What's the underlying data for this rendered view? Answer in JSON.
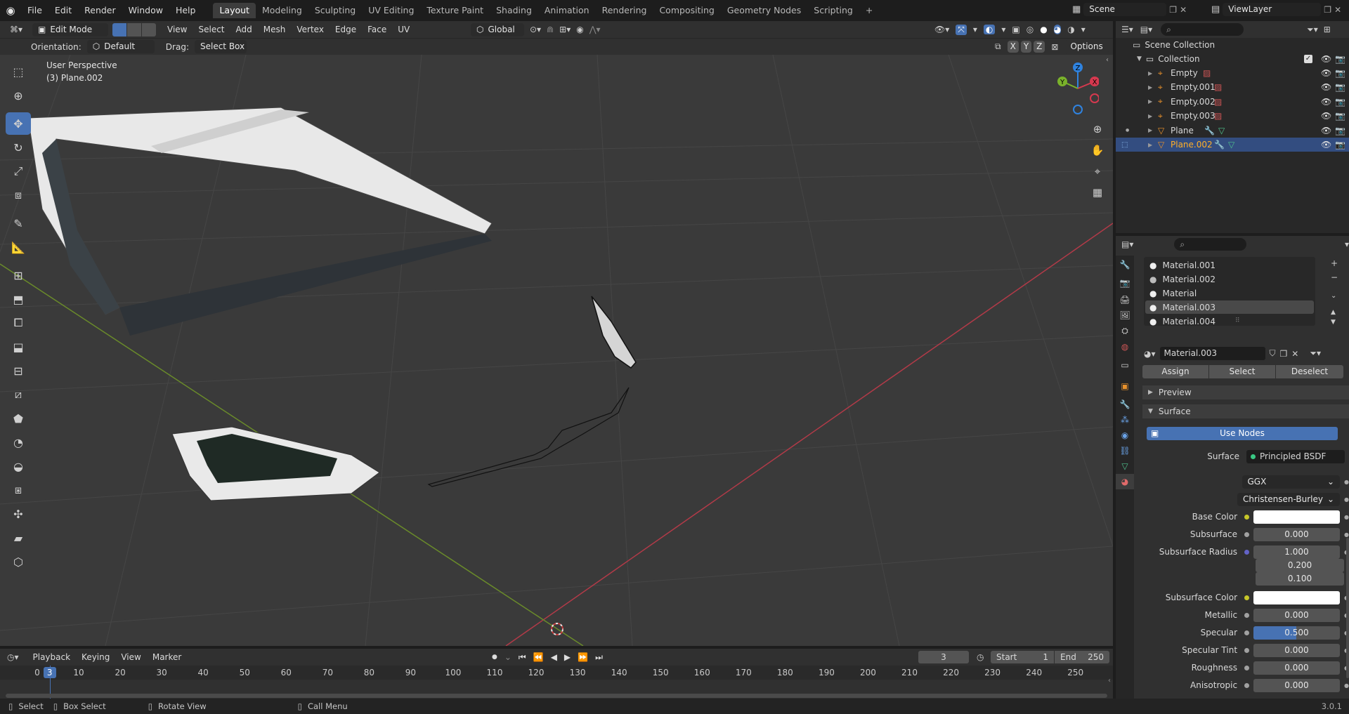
{
  "topbar": {
    "menus": [
      "File",
      "Edit",
      "Render",
      "Window",
      "Help"
    ],
    "workspaces": [
      "Layout",
      "Modeling",
      "Sculpting",
      "UV Editing",
      "Texture Paint",
      "Shading",
      "Animation",
      "Rendering",
      "Compositing",
      "Geometry Nodes",
      "Scripting"
    ],
    "active_workspace": "Layout",
    "add_tab": "+",
    "scene": "Scene",
    "view_layer": "ViewLayer"
  },
  "viewport_header": {
    "mode": "Edit Mode",
    "menus": [
      "View",
      "Select",
      "Add",
      "Mesh",
      "Vertex",
      "Edge",
      "Face",
      "UV"
    ],
    "transform_orientation": "Global",
    "axes": [
      "X",
      "Y",
      "Z"
    ]
  },
  "tool_settings": {
    "orientation_label": "Orientation:",
    "orientation_value": "Default",
    "drag_label": "Drag:",
    "drag_value": "Select Box",
    "options": "Options"
  },
  "viewport": {
    "view_name": "User Perspective",
    "object_info": "(3) Plane.002",
    "gizmo_labels": {
      "z": "Z",
      "y": "Y",
      "x": "X"
    },
    "colors": {
      "x_axis": "#b23a48",
      "y_axis": "#6a8b2a",
      "grid": "#444444",
      "background": "#3a3a3a"
    }
  },
  "outliner": {
    "root": "Scene Collection",
    "collection": "Collection",
    "items": [
      {
        "name": "Empty",
        "type": "empty",
        "selected": false
      },
      {
        "name": "Empty.001",
        "type": "empty",
        "selected": false
      },
      {
        "name": "Empty.002",
        "type": "empty",
        "selected": false
      },
      {
        "name": "Empty.003",
        "type": "empty",
        "selected": false
      },
      {
        "name": "Plane",
        "type": "mesh",
        "selected": false
      },
      {
        "name": "Plane.002",
        "type": "mesh",
        "selected": true
      }
    ]
  },
  "properties": {
    "material_slots": [
      "Material.001",
      "Material.002",
      "Material",
      "Material.003",
      "Material.004"
    ],
    "active_slot": "Material.003",
    "material_name": "Material.003",
    "buttons": {
      "assign": "Assign",
      "select": "Select",
      "deselect": "Deselect"
    },
    "panels": {
      "preview": "Preview",
      "surface": "Surface"
    },
    "use_nodes": "Use Nodes",
    "surface_label": "Surface",
    "surface_shader": "Principled BSDF",
    "distribution": "GGX",
    "subsurface_method": "Christensen-Burley",
    "fields": [
      {
        "label": "Base Color",
        "value": "",
        "socket": "#c7c729",
        "type": "color"
      },
      {
        "label": "Subsurface",
        "value": "0.000",
        "socket": "#a1a1a1",
        "type": "num"
      },
      {
        "label": "Subsurface Radius",
        "value": "1.000",
        "socket": "#6363c7",
        "type": "num"
      },
      {
        "label": "",
        "value": "0.200",
        "socket": "",
        "type": "num"
      },
      {
        "label": "",
        "value": "0.100",
        "socket": "",
        "type": "num"
      },
      {
        "label": "Subsurface Color",
        "value": "",
        "socket": "#c7c729",
        "type": "color"
      },
      {
        "label": "Metallic",
        "value": "0.000",
        "socket": "#a1a1a1",
        "type": "num"
      },
      {
        "label": "Specular",
        "value": "0.500",
        "socket": "#a1a1a1",
        "type": "slider",
        "fill": 0.5
      },
      {
        "label": "Specular Tint",
        "value": "0.000",
        "socket": "#a1a1a1",
        "type": "num"
      },
      {
        "label": "Roughness",
        "value": "0.000",
        "socket": "#a1a1a1",
        "type": "num"
      },
      {
        "label": "Anisotropic",
        "value": "0.000",
        "socket": "#a1a1a1",
        "type": "num"
      }
    ]
  },
  "timeline": {
    "menus": [
      "Playback",
      "Keying",
      "View",
      "Marker"
    ],
    "current_frame": "3",
    "start_label": "Start",
    "start": "1",
    "end_label": "End",
    "end": "250",
    "ticks": [
      "0",
      "10",
      "20",
      "30",
      "40",
      "50",
      "60",
      "70",
      "80",
      "90",
      "100",
      "110",
      "120",
      "130",
      "140",
      "150",
      "160",
      "170",
      "180",
      "190",
      "200",
      "210",
      "220",
      "230",
      "240",
      "250"
    ],
    "playhead": "3"
  },
  "statusbar": {
    "select": "Select",
    "box_select": "Box Select",
    "rotate_view": "Rotate View",
    "call_menu": "Call Menu",
    "version": "3.0.1"
  },
  "accent": "#4772b3"
}
